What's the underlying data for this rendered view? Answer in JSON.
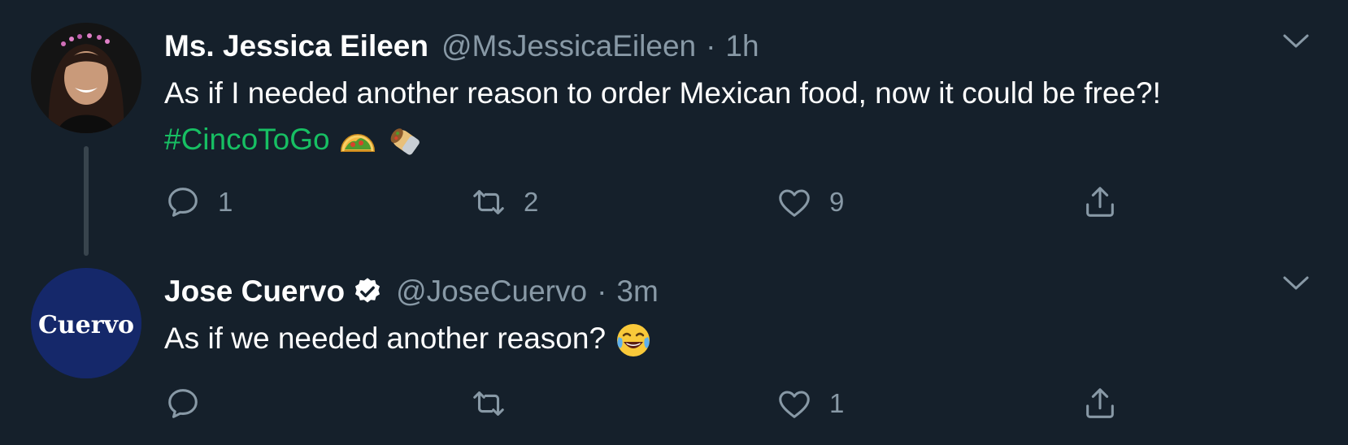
{
  "tweets": [
    {
      "author": {
        "name": "Ms. Jessica Eileen",
        "handle": "@MsJessicaEileen",
        "verified": false
      },
      "separator": "·",
      "time": "1h",
      "text_before": "As if I needed another reason to order Mexican food, now it could be free?!",
      "hashtag": "#CincoToGo",
      "emojis": [
        "taco",
        "burrito"
      ],
      "actions": {
        "reply_count": "1",
        "retweet_count": "2",
        "like_count": "9",
        "share_count": ""
      }
    },
    {
      "author": {
        "name": "Jose Cuervo",
        "handle": "@JoseCuervo",
        "verified": true,
        "avatar_text": "Cuervo"
      },
      "separator": "·",
      "time": "3m",
      "text_before": "As if we needed another reason?",
      "emojis": [
        "face-with-tears-of-joy"
      ],
      "actions": {
        "reply_count": "",
        "retweet_count": "",
        "like_count": "1",
        "share_count": ""
      }
    }
  ],
  "colors": {
    "background": "#15202b",
    "text_primary": "#ffffff",
    "text_secondary": "#8899a6",
    "hashtag": "#17bf63",
    "thread_line": "#38444d"
  }
}
